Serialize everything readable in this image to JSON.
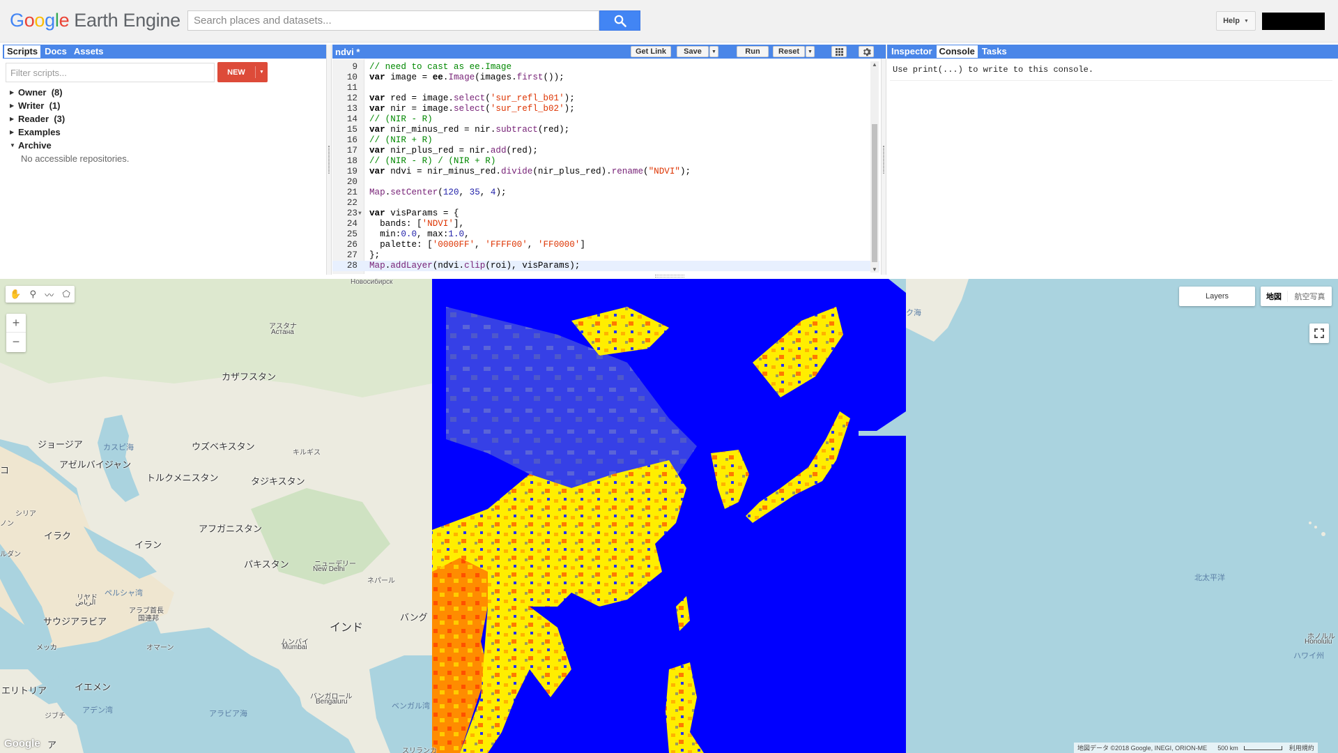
{
  "app": {
    "logo_google": "Google",
    "logo_product": "Earth Engine",
    "search_placeholder": "Search places and datasets...",
    "help_label": "Help"
  },
  "left_panel": {
    "tabs": [
      "Scripts",
      "Docs",
      "Assets"
    ],
    "active_tab": "Scripts",
    "filter_placeholder": "Filter scripts...",
    "new_label": "NEW",
    "tree": [
      {
        "label": "Owner",
        "count": "(8)",
        "expanded": false
      },
      {
        "label": "Writer",
        "count": "(1)",
        "expanded": false
      },
      {
        "label": "Reader",
        "count": "(3)",
        "expanded": false
      },
      {
        "label": "Examples",
        "count": "",
        "expanded": false
      },
      {
        "label": "Archive",
        "count": "",
        "expanded": true
      }
    ],
    "archive_empty": "No accessible repositories."
  },
  "editor": {
    "script_name": "ndvi *",
    "buttons": {
      "get_link": "Get Link",
      "save": "Save",
      "run": "Run",
      "reset": "Reset"
    },
    "lines": [
      {
        "n": "9",
        "t": "// need to cast as ee.Image"
      },
      {
        "n": "10",
        "t": "var image = ee.Image(images.first());"
      },
      {
        "n": "11",
        "t": ""
      },
      {
        "n": "12",
        "t": "var red = image.select('sur_refl_b01');"
      },
      {
        "n": "13",
        "t": "var nir = image.select('sur_refl_b02');"
      },
      {
        "n": "14",
        "t": "// (NIR - R)"
      },
      {
        "n": "15",
        "t": "var nir_minus_red = nir.subtract(red);"
      },
      {
        "n": "16",
        "t": "// (NIR + R)"
      },
      {
        "n": "17",
        "t": "var nir_plus_red = nir.add(red);"
      },
      {
        "n": "18",
        "t": "// (NIR - R) / (NIR + R)"
      },
      {
        "n": "19",
        "t": "var ndvi = nir_minus_red.divide(nir_plus_red).rename(\"NDVI\");"
      },
      {
        "n": "20",
        "t": ""
      },
      {
        "n": "21",
        "t": "Map.setCenter(120, 35, 4);"
      },
      {
        "n": "22",
        "t": ""
      },
      {
        "n": "23",
        "t": "var visParams = {"
      },
      {
        "n": "24",
        "t": "  bands: ['NDVI'],"
      },
      {
        "n": "25",
        "t": "  min:0.0, max:1.0,"
      },
      {
        "n": "26",
        "t": "  palette: ['0000FF', 'FFFF00', 'FF0000']"
      },
      {
        "n": "27",
        "t": "};"
      },
      {
        "n": "28",
        "t": "Map.addLayer(ndvi.clip(roi), visParams);"
      }
    ]
  },
  "right_panel": {
    "tabs": [
      "Inspector",
      "Console",
      "Tasks"
    ],
    "active_tab": "Console",
    "console_message": "Use print(...) to write to this console."
  },
  "map": {
    "layers_label": "Layers",
    "maptype_map": "地図",
    "maptype_satellite": "航空写真",
    "google_logo": "Google",
    "attribution": "地図データ ©2018 Google, INEGI, ORION-ME",
    "scale": "500 km",
    "terms": "利用規約",
    "labels": {
      "novosibirsk": "Новосибирск",
      "astana_jp": "アスタナ",
      "astana_ru": "Астана",
      "kazakhstan": "カザフスタン",
      "georgia": "ジョージア",
      "caspian": "カスピ海",
      "azerbaijan": "アゼルバイジャン",
      "uzbekistan": "ウズベキスタン",
      "kyrgyzstan": "キルギス",
      "turkmenistan": "トルクメニスタン",
      "tajikistan": "タジキスタン",
      "syria": "シリア",
      "iraq": "イラク",
      "iran": "イラン",
      "afghanistan": "アフガニスタン",
      "pakistan": "パキスタン",
      "new_delhi_jp": "ニューデリー",
      "new_delhi": "New Delhi",
      "nepal": "ネパール",
      "riyadh_jp": "リヤド",
      "riyadh_ar": "الرياض",
      "saudi": "サウジアラビア",
      "persian_gulf": "ペルシャ湾",
      "uae1": "アラブ首長",
      "uae2": "国連邦",
      "mecca": "メッカ",
      "oman": "オマーン",
      "india": "インド",
      "mumbai_jp": "ムンバイ",
      "mumbai": "Mumbai",
      "bangalore_jp": "バンガロール",
      "bangalore": "Bengaluru",
      "bangladesh": "バング",
      "bay_of_bengal": "ベンガル湾",
      "arabian_sea": "アラビア海",
      "eritrea": "エリトリア",
      "yemen": "イエメン",
      "djibouti": "ジブチ",
      "gulf_aden": "アデン湾",
      "sri_lanka": "スリランカ",
      "okhotsk": "ク海",
      "north_pacific": "北太平洋",
      "honolulu_jp": "ホノルル",
      "honolulu": "Honolulu",
      "hawaii": "ハワイ州",
      "edge_a": "コ",
      "edge_b": "ノン",
      "edge_c": "ルダン",
      "edge_d": "ア"
    }
  },
  "colors": {
    "accent": "#4a86e8",
    "new_button": "#dd4b39",
    "ndvi_low": "#0000FF",
    "ndvi_mid": "#FFFF00",
    "ndvi_high": "#FF0000"
  }
}
